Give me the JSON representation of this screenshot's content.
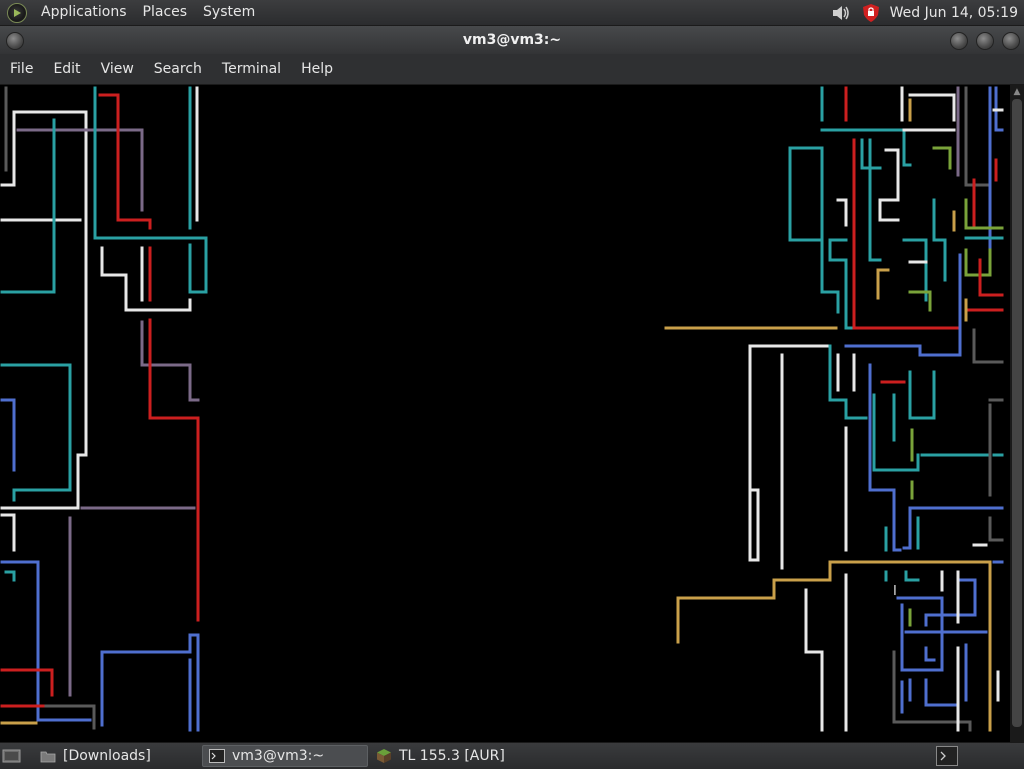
{
  "top_panel": {
    "menus": [
      "Applications",
      "Places",
      "System"
    ],
    "clock": "Wed Jun 14, 05:19",
    "tray": [
      "volume-icon",
      "shield-icon"
    ]
  },
  "window": {
    "title": "vm3@vm3:~",
    "menu": [
      "File",
      "Edit",
      "View",
      "Search",
      "Terminal",
      "Help"
    ]
  },
  "terminal": {
    "program": "pipes screensaver",
    "pipe_colors": {
      "white": "#e8e8e8",
      "teal": "#2aa1a3",
      "red": "#cc1f1f",
      "blue": "#4f6fcf",
      "purple": "#7b6a88",
      "gold": "#c9a04a",
      "green": "#7aa33a",
      "gray": "#5a5a5a"
    }
  },
  "taskbar": {
    "tasks": [
      {
        "label": "[Downloads]",
        "icon": "folder-icon",
        "active": false
      },
      {
        "label": "vm3@vm3:~",
        "icon": "terminal-icon",
        "active": true
      },
      {
        "label": "TL 155.3 [AUR]",
        "icon": "minecraft-icon",
        "active": false
      }
    ]
  }
}
